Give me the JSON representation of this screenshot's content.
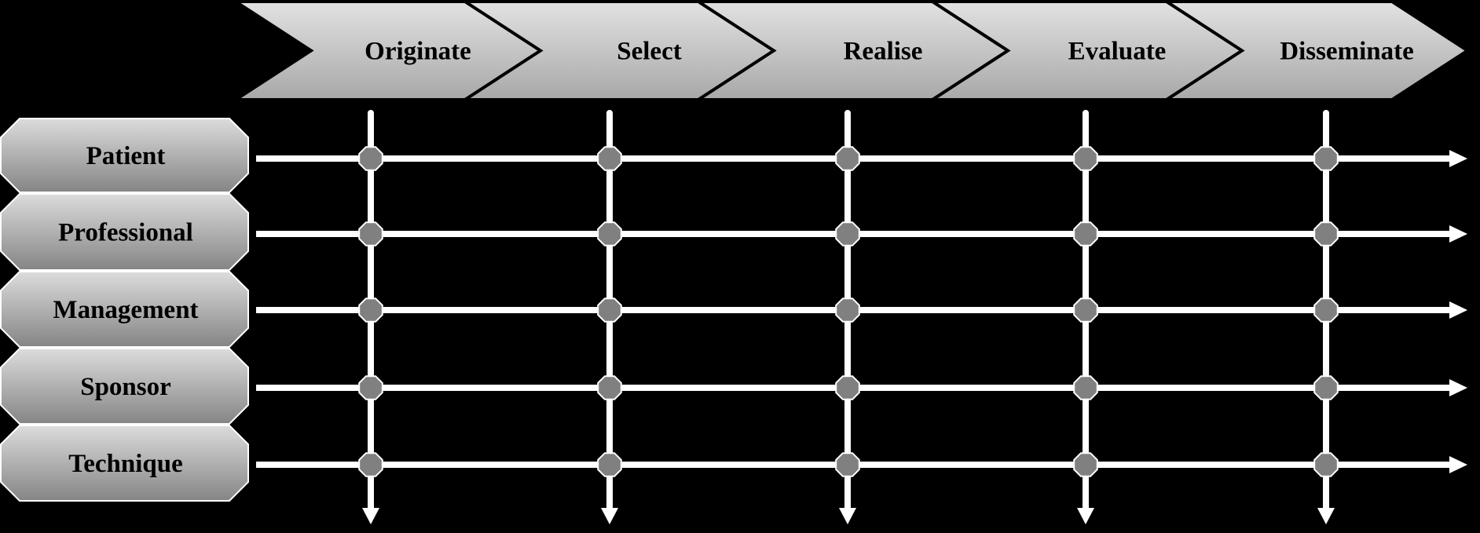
{
  "stages": [
    "Originate",
    "Select",
    "Realise",
    "Evaluate",
    "Disseminate"
  ],
  "actors": [
    "Patient",
    "Professional",
    "Management",
    "Sponsor",
    "Technique"
  ],
  "colors": {
    "background": "#000000",
    "shape_gradient_top": "#e2e2e2",
    "shape_gradient_bottom": "#8a8a8a",
    "lines": "#ffffff",
    "node_fill": "#808080"
  }
}
